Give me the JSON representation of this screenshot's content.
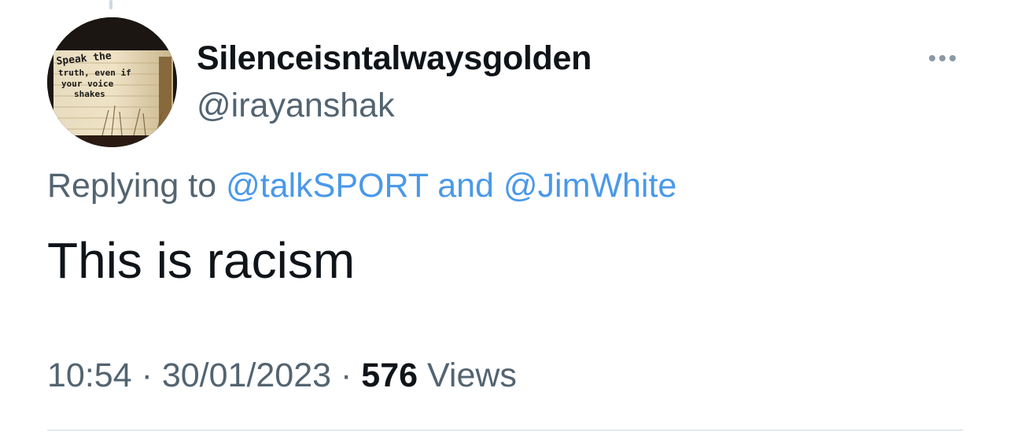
{
  "tweet": {
    "author": {
      "display_name": "Silenceisntalwaysgolden",
      "handle": "@irayanshak",
      "avatar_text": "Speak the truth, even if your voice shakes"
    },
    "replying_to": {
      "prefix": "Replying to",
      "mentions": [
        "@talkSPORT",
        "@JimWhite"
      ],
      "joiner": "and"
    },
    "text": "This is racism",
    "meta": {
      "time": "10:54",
      "separator": "·",
      "date": "30/01/2023",
      "views_count": "576",
      "views_label": "Views"
    },
    "more_icon": "more-horizontal-icon"
  },
  "colors": {
    "link": "#4a99e9",
    "secondary_text": "#536471",
    "primary_text": "#0f1419",
    "divider": "#cfd9de"
  }
}
